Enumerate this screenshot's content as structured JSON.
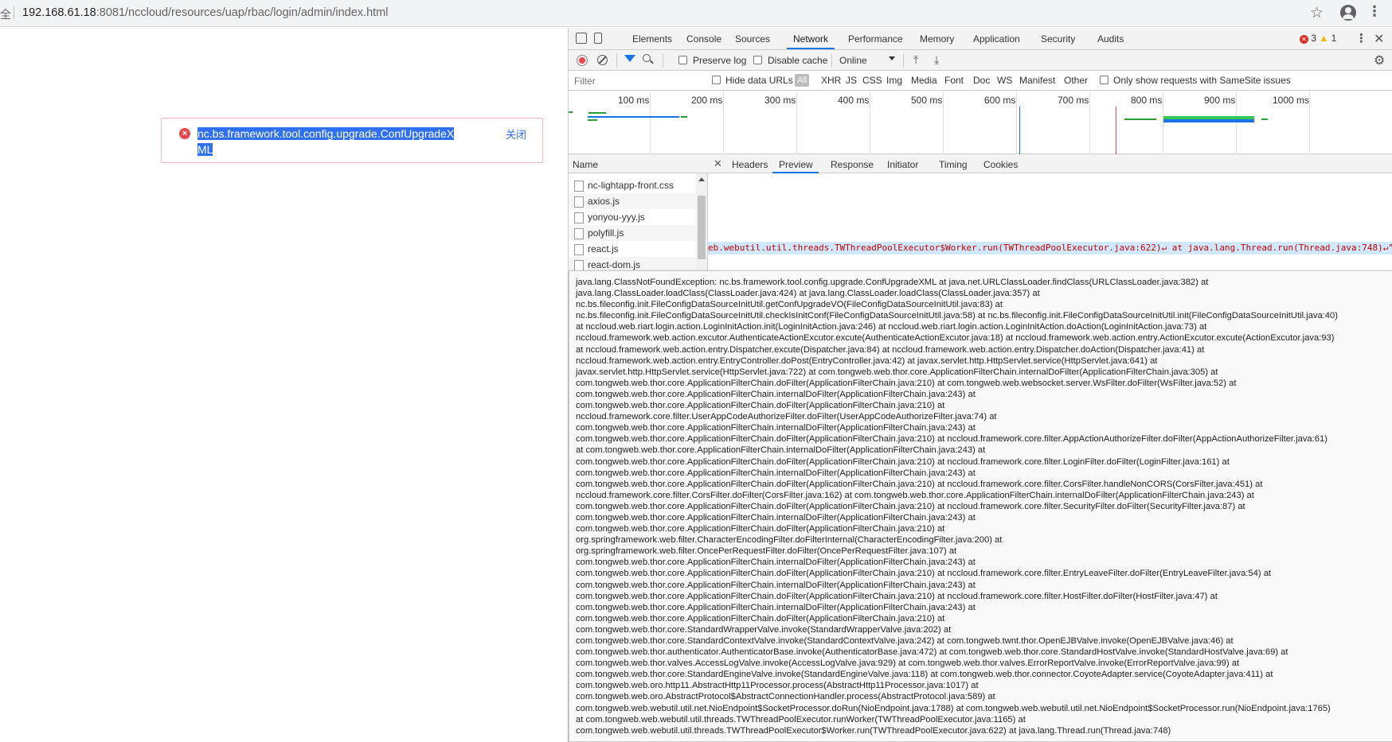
{
  "address_bar": {
    "prefix": "全",
    "url_host": "192.168.61.18",
    "url_rest": ":8081/nccloud/resources/uap/rbac/login/admin/index.html"
  },
  "error_toast": {
    "message": "nc.bs.framework.tool.config.upgrade.ConfUpgradeXML",
    "close_label": "关闭",
    "error_color": "#e8474c"
  },
  "devtools": {
    "tabs": [
      "Elements",
      "Console",
      "Sources",
      "Network",
      "Performance",
      "Memory",
      "Application",
      "Security",
      "Audits"
    ],
    "active_tab": "Network",
    "error_count": "3",
    "warning_count": "1",
    "toolbar": {
      "preserve_log": "Preserve log",
      "disable_cache": "Disable cache",
      "throttle": "Online"
    },
    "filter": {
      "placeholder": "Filter",
      "hide_data_urls": "Hide data URLs",
      "types": [
        "All",
        "XHR",
        "JS",
        "CSS",
        "Img",
        "Media",
        "Font",
        "Doc",
        "WS",
        "Manifest",
        "Other"
      ],
      "samesite": "Only show requests with SameSite issues"
    },
    "timeline_labels": [
      "100 ms",
      "200 ms",
      "300 ms",
      "400 ms",
      "500 ms",
      "600 ms",
      "700 ms",
      "800 ms",
      "900 ms",
      "1000 ms"
    ],
    "name_header": "Name",
    "requests": [
      "nc-lightapp-front.css",
      "axios.js",
      "yonyou-yyy.js",
      "polyfill.js",
      "react.js",
      "react-dom.js"
    ],
    "preview_tabs": [
      "Headers",
      "Preview",
      "Response",
      "Initiator",
      "Timing",
      "Cookies"
    ],
    "active_preview_tab": "Preview",
    "preview_highlight": "eb.webutil.util.threads.TWThreadPoolExecutor$Worker.run(TWThreadPoolExecutor.java:622)↵ at java.lang.Thread.run(Thread.java:748)↵\"",
    "stack_trace": "java.lang.ClassNotFoundException: nc.bs.framework.tool.config.upgrade.ConfUpgradeXML at java.net.URLClassLoader.findClass(URLClassLoader.java:382) at\njava.lang.ClassLoader.loadClass(ClassLoader.java:424) at java.lang.ClassLoader.loadClass(ClassLoader.java:357) at\nnc.bs.fileconfig.init.FileConfigDataSourceInitUtil.getConfUpgradeVO(FileConfigDataSourceInitUtil.java:83) at\nnc.bs.fileconfig.init.FileConfigDataSourceInitUtil.checkIsInitConf(FileConfigDataSourceInitUtil.java:58) at nc.bs.fileconfig.init.FileConfigDataSourceInitUtil.init(FileConfigDataSourceInitUtil.java:40)\nat nccloud.web.riart.login.action.LoginInitAction.init(LoginInitAction.java:246) at nccloud.web.riart.login.action.LoginInitAction.doAction(LoginInitAction.java:73) at\nnccloud.framework.web.action.excutor.AuthenticateActionExcutor.excute(AuthenticateActionExcutor.java:18) at nccloud.framework.web.action.entry.ActionExcutor.excute(ActionExcutor.java:93)\nat nccloud.framework.web.action.entry.Dispatcher.excute(Dispatcher.java:84) at nccloud.framework.web.action.entry.Dispatcher.doAction(Dispatcher.java:41) at\nnccloud.framework.web.action.entry.EntryController.doPost(EntryController.java:42) at javax.servlet.http.HttpServlet.service(HttpServlet.java:641) at\njavax.servlet.http.HttpServlet.service(HttpServlet.java:722) at com.tongweb.web.thor.core.ApplicationFilterChain.internalDoFilter(ApplicationFilterChain.java:305) at\ncom.tongweb.web.thor.core.ApplicationFilterChain.doFilter(ApplicationFilterChain.java:210) at com.tongweb.web.websocket.server.WsFilter.doFilter(WsFilter.java:52) at\ncom.tongweb.web.thor.core.ApplicationFilterChain.internalDoFilter(ApplicationFilterChain.java:243) at\ncom.tongweb.web.thor.core.ApplicationFilterChain.doFilter(ApplicationFilterChain.java:210) at\nnccloud.framework.core.filter.UserAppCodeAuthorizeFilter.doFilter(UserAppCodeAuthorizeFilter.java:74) at\ncom.tongweb.web.thor.core.ApplicationFilterChain.internalDoFilter(ApplicationFilterChain.java:243) at\ncom.tongweb.web.thor.core.ApplicationFilterChain.doFilter(ApplicationFilterChain.java:210) at nccloud.framework.core.filter.AppActionAuthorizeFilter.doFilter(AppActionAuthorizeFilter.java:61)\nat com.tongweb.web.thor.core.ApplicationFilterChain.internalDoFilter(ApplicationFilterChain.java:243) at\ncom.tongweb.web.thor.core.ApplicationFilterChain.doFilter(ApplicationFilterChain.java:210) at nccloud.framework.core.filter.LoginFilter.doFilter(LoginFilter.java:161) at\ncom.tongweb.web.thor.core.ApplicationFilterChain.internalDoFilter(ApplicationFilterChain.java:243) at\ncom.tongweb.web.thor.core.ApplicationFilterChain.doFilter(ApplicationFilterChain.java:210) at nccloud.framework.core.filter.CorsFilter.handleNonCORS(CorsFilter.java:451) at\nnccloud.framework.core.filter.CorsFilter.doFilter(CorsFilter.java:162) at com.tongweb.web.thor.core.ApplicationFilterChain.internalDoFilter(ApplicationFilterChain.java:243) at\ncom.tongweb.web.thor.core.ApplicationFilterChain.doFilter(ApplicationFilterChain.java:210) at nccloud.framework.core.filter.SecurityFilter.doFilter(SecurityFilter.java:87) at\ncom.tongweb.web.thor.core.ApplicationFilterChain.internalDoFilter(ApplicationFilterChain.java:243) at\ncom.tongweb.web.thor.core.ApplicationFilterChain.doFilter(ApplicationFilterChain.java:210) at\norg.springframework.web.filter.CharacterEncodingFilter.doFilterInternal(CharacterEncodingFilter.java:200) at\norg.springframework.web.filter.OncePerRequestFilter.doFilter(OncePerRequestFilter.java:107) at\ncom.tongweb.web.thor.core.ApplicationFilterChain.internalDoFilter(ApplicationFilterChain.java:243) at\ncom.tongweb.web.thor.core.ApplicationFilterChain.doFilter(ApplicationFilterChain.java:210) at nccloud.framework.core.filter.EntryLeaveFilter.doFilter(EntryLeaveFilter.java:54) at\ncom.tongweb.web.thor.core.ApplicationFilterChain.internalDoFilter(ApplicationFilterChain.java:243) at\ncom.tongweb.web.thor.core.ApplicationFilterChain.doFilter(ApplicationFilterChain.java:210) at nccloud.framework.core.filter.HostFilter.doFilter(HostFilter.java:47) at\ncom.tongweb.web.thor.core.ApplicationFilterChain.internalDoFilter(ApplicationFilterChain.java:243) at\ncom.tongweb.web.thor.core.ApplicationFilterChain.doFilter(ApplicationFilterChain.java:210) at\ncom.tongweb.web.thor.core.StandardWrapperValve.invoke(StandardWrapperValve.java:202) at\ncom.tongweb.web.thor.core.StandardContextValve.invoke(StandardContextValve.java:242) at com.tongweb.twnt.thor.OpenEJBValve.invoke(OpenEJBValve.java:46) at\ncom.tongweb.web.thor.authenticator.AuthenticatorBase.invoke(AuthenticatorBase.java:472) at com.tongweb.web.thor.core.StandardHostValve.invoke(StandardHostValve.java:69) at\ncom.tongweb.web.thor.valves.AccessLogValve.invoke(AccessLogValve.java:929) at com.tongweb.web.thor.valves.ErrorReportValve.invoke(ErrorReportValve.java:99) at\ncom.tongweb.web.thor.core.StandardEngineValve.invoke(StandardEngineValve.java:118) at com.tongweb.web.thor.connector.CoyoteAdapter.service(CoyoteAdapter.java:411) at\ncom.tongweb.web.oro.http11.AbstractHttp11Processor.process(AbstractHttp11Processor.java:1017) at\ncom.tongweb.web.oro.AbstractProtocol$AbstractConnectionHandler.process(AbstractProtocol.java:589) at\ncom.tongweb.web.webutil.util.net.NioEndpoint$SocketProcessor.doRun(NioEndpoint.java:1788) at com.tongweb.web.webutil.util.net.NioEndpoint$SocketProcessor.run(NioEndpoint.java:1765)\nat com.tongweb.web.webutil.util.threads.TWThreadPoolExecutor.runWorker(TWThreadPoolExecutor.java:1165) at\ncom.tongweb.web.webutil.util.threads.TWThreadPoolExecutor$Worker.run(TWThreadPoolExecutor.java:622) at java.lang.Thread.run(Thread.java:748)"
  }
}
